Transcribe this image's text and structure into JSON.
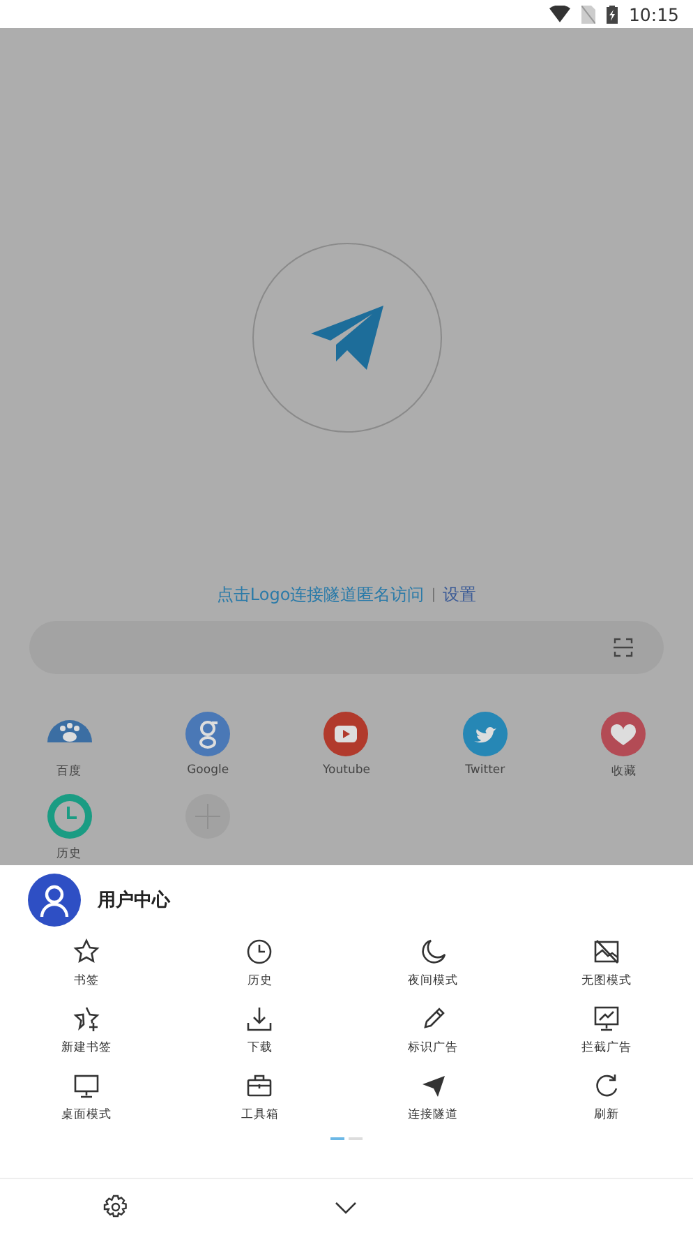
{
  "status_bar": {
    "time": "10:15"
  },
  "home": {
    "hint": "点击Logo连接隧道匿名访问",
    "separator": "|",
    "settings_link": "设置",
    "shortcuts": [
      {
        "kind": "site",
        "label": "百度"
      },
      {
        "kind": "site",
        "label": "Google"
      },
      {
        "kind": "site",
        "label": "Youtube"
      },
      {
        "kind": "site",
        "label": "Twitter"
      },
      {
        "kind": "site",
        "label": "收藏"
      },
      {
        "kind": "site",
        "label": "历史"
      },
      {
        "kind": "add"
      }
    ]
  },
  "menu": {
    "user": {
      "label": "用户中心"
    },
    "items": [
      {
        "label": "书签"
      },
      {
        "label": "历史"
      },
      {
        "label": "夜间模式"
      },
      {
        "label": "无图模式"
      },
      {
        "label": "新建书签"
      },
      {
        "label": "下载"
      },
      {
        "label": "标识广告"
      },
      {
        "label": "拦截广告"
      },
      {
        "label": "桌面模式"
      },
      {
        "label": "工具箱"
      },
      {
        "label": "连接隧道"
      },
      {
        "label": "刷新"
      }
    ],
    "pages": [
      {
        "selected": true
      },
      {
        "selected": false
      }
    ]
  }
}
